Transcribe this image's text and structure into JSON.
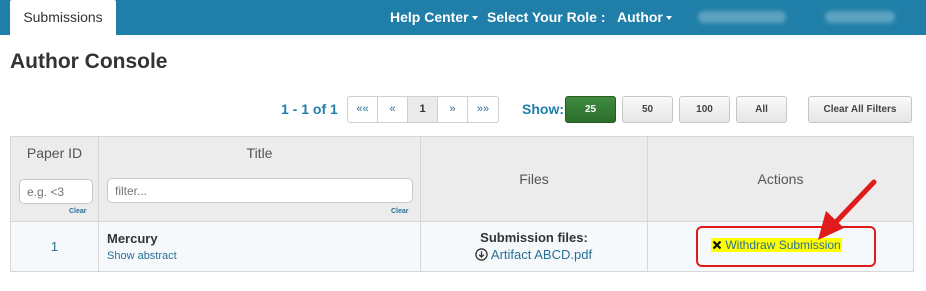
{
  "nav": {
    "active_tab": "Submissions",
    "help_center": "Help Center",
    "select_role_label": "Select Your Role :",
    "role": "Author"
  },
  "page": {
    "title": "Author Console"
  },
  "pagination": {
    "range_text": "1 - 1 of 1",
    "first": "««",
    "prev": "«",
    "current": "1",
    "next": "»",
    "last": "»»",
    "show_label": "Show:",
    "page_sizes": [
      "25",
      "50",
      "100",
      "All"
    ],
    "selected_size": "25",
    "clear_filters": "Clear All Filters"
  },
  "table": {
    "columns": {
      "paper_id": "Paper ID",
      "title": "Title",
      "files": "Files",
      "actions": "Actions"
    },
    "filters": {
      "paper_id_placeholder": "e.g. <3",
      "title_placeholder": "filter...",
      "clear_label": "Clear"
    },
    "rows": [
      {
        "paper_id": "1",
        "title": "Mercury",
        "show_abstract": "Show abstract",
        "files_label": "Submission files:",
        "file_name": "Artifact ABCD.pdf",
        "action": "Withdraw Submission"
      }
    ]
  },
  "colors": {
    "navbar": "#1f7fa8",
    "link": "#2a6f97",
    "active_page_size": "#2d6e2d",
    "highlight": "#ffff00",
    "annotation": "#e01b1b"
  },
  "icons": {
    "download": "download-icon",
    "withdraw": "close-icon",
    "caret": "caret-down-icon"
  }
}
